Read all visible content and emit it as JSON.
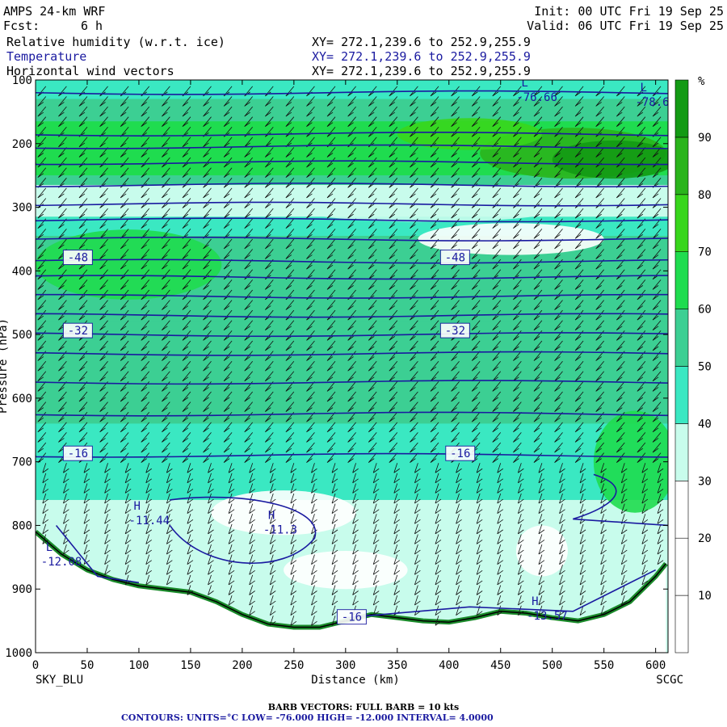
{
  "header": {
    "model": "AMPS 24-km WRF",
    "fcst_label": "Fcst:",
    "fcst_value": "6 h",
    "init": "Init: 00 UTC Fri 19 Sep 25",
    "valid": "Valid: 06 UTC Fri 19 Sep 25",
    "fields": [
      {
        "name": "Relative humidity (w.r.t. ice)",
        "xy": "XY= 272.1,239.6 to 252.9,255.9"
      },
      {
        "name": "Temperature",
        "xy": "XY= 272.1,239.6 to 252.9,255.9"
      },
      {
        "name": "Horizontal wind vectors",
        "xy": "XY= 272.1,239.6 to 252.9,255.9"
      }
    ]
  },
  "colors": {
    "temperature": "#1a1aa0",
    "terrain": "#000000",
    "rh_scale": [
      "#ffffff",
      "#ffffff",
      "#ffffff",
      "#c8fcec",
      "#3ae8c2",
      "#3ccf93",
      "#1fdc4f",
      "#38d61c",
      "#2ab41c",
      "#139a14",
      "#0a700f"
    ]
  },
  "chart_data": {
    "type": "heatmap",
    "title": "Relative humidity (w.r.t. ice)",
    "xlabel": "Distance (km)",
    "ylabel": "Pressure (hPa)",
    "x_start_label": "SKY_BLU",
    "x_end_label": "SCGC",
    "xlim": [
      0,
      600
    ],
    "ylim": [
      1000,
      100
    ],
    "x_ticks": [
      0,
      50,
      100,
      150,
      200,
      250,
      300,
      350,
      400,
      450,
      500,
      550,
      600
    ],
    "y_ticks": [
      100,
      200,
      300,
      400,
      500,
      600,
      700,
      800,
      900,
      1000
    ],
    "colorbar": {
      "unit": "%",
      "levels": [
        0,
        10,
        20,
        30,
        40,
        50,
        60,
        70,
        80,
        90,
        100
      ],
      "tick_labels": [
        "10",
        "20",
        "30",
        "40",
        "50",
        "60",
        "70",
        "80",
        "90"
      ]
    },
    "rh_bands": [
      {
        "p_top": 100,
        "p_bot": 130,
        "rh": 45
      },
      {
        "p_top": 130,
        "p_bot": 165,
        "rh": 55
      },
      {
        "p_top": 165,
        "p_bot": 250,
        "rh": 65
      },
      {
        "p_top": 250,
        "p_bot": 265,
        "rh": 55
      },
      {
        "p_top": 265,
        "p_bot": 315,
        "rh": 35
      },
      {
        "p_top": 315,
        "p_bot": 345,
        "rh": 45
      },
      {
        "p_top": 345,
        "p_bot": 430,
        "rh": 55
      },
      {
        "p_top": 430,
        "p_bot": 480,
        "rh": 55
      },
      {
        "p_top": 480,
        "p_bot": 640,
        "rh": 55
      },
      {
        "p_top": 640,
        "p_bot": 760,
        "rh": 45
      },
      {
        "p_top": 760,
        "p_bot": 1000,
        "rh": 35
      }
    ],
    "rh_features": [
      {
        "x": 520,
        "p": 215,
        "rx": 90,
        "rp": 40,
        "rh": 85
      },
      {
        "x": 560,
        "p": 225,
        "rx": 60,
        "rp": 30,
        "rh": 92
      },
      {
        "x": 420,
        "p": 185,
        "rx": 70,
        "rp": 25,
        "rh": 75
      },
      {
        "x": 90,
        "p": 390,
        "rx": 90,
        "rp": 55,
        "rh": 65
      },
      {
        "x": 380,
        "p": 305,
        "rx": 120,
        "rp": 18,
        "rh": 35
      },
      {
        "x": 460,
        "p": 350,
        "rx": 90,
        "rp": 25,
        "rh": 25
      },
      {
        "x": 240,
        "p": 780,
        "rx": 70,
        "rp": 35,
        "rh": 25
      },
      {
        "x": 300,
        "p": 870,
        "rx": 60,
        "rp": 30,
        "rh": 25
      },
      {
        "x": 490,
        "p": 840,
        "rx": 25,
        "rp": 40,
        "rh": 25
      },
      {
        "x": 580,
        "p": 700,
        "rx": 40,
        "rp": 80,
        "rh": 65
      }
    ],
    "isotherms": [
      {
        "label": "-76.66",
        "p": 120
      },
      {
        "label": "",
        "p": 185
      },
      {
        "label": "",
        "p": 205
      },
      {
        "label": "",
        "p": 230
      },
      {
        "label": "",
        "p": 265
      },
      {
        "label": "",
        "p": 295
      },
      {
        "label": "",
        "p": 320
      },
      {
        "label": "",
        "p": 350
      },
      {
        "label": "-48",
        "p": 385
      },
      {
        "label": "",
        "p": 410
      },
      {
        "label": "",
        "p": 440
      },
      {
        "label": "",
        "p": 470
      },
      {
        "label": "-32",
        "p": 500
      },
      {
        "label": "",
        "p": 530
      },
      {
        "label": "",
        "p": 575
      },
      {
        "label": "",
        "p": 625
      },
      {
        "label": "-16",
        "p": 690
      }
    ],
    "contour_labels": [
      {
        "text": "-48",
        "x": 30,
        "p": 380
      },
      {
        "text": "-48",
        "x": 395,
        "p": 380
      },
      {
        "text": "-32",
        "x": 30,
        "p": 495
      },
      {
        "text": "-32",
        "x": 395,
        "p": 495
      },
      {
        "text": "-16",
        "x": 30,
        "p": 688
      },
      {
        "text": "-16",
        "x": 400,
        "p": 688
      },
      {
        "text": "-16",
        "x": 295,
        "p": 945
      }
    ],
    "extrema": [
      {
        "type": "H",
        "value": "-11.44",
        "x": 95,
        "p": 775
      },
      {
        "type": "H",
        "value": "-11.3",
        "x": 225,
        "p": 790
      },
      {
        "type": "L",
        "value": "-12.08",
        "x": 10,
        "p": 840
      },
      {
        "type": "H",
        "value": "-13.57",
        "x": 480,
        "p": 925
      },
      {
        "type": "L",
        "value": "-76.66",
        "x": 470,
        "p": 110
      },
      {
        "type": "L",
        "value": "-78.6",
        "x": 585,
        "p": 118
      }
    ],
    "terrain_pressure": [
      {
        "x": 0,
        "p": 810
      },
      {
        "x": 25,
        "p": 845
      },
      {
        "x": 50,
        "p": 870
      },
      {
        "x": 75,
        "p": 885
      },
      {
        "x": 100,
        "p": 895
      },
      {
        "x": 125,
        "p": 900
      },
      {
        "x": 150,
        "p": 905
      },
      {
        "x": 175,
        "p": 920
      },
      {
        "x": 200,
        "p": 940
      },
      {
        "x": 225,
        "p": 955
      },
      {
        "x": 250,
        "p": 960
      },
      {
        "x": 275,
        "p": 960
      },
      {
        "x": 300,
        "p": 950
      },
      {
        "x": 325,
        "p": 940
      },
      {
        "x": 350,
        "p": 945
      },
      {
        "x": 375,
        "p": 950
      },
      {
        "x": 400,
        "p": 952
      },
      {
        "x": 425,
        "p": 945
      },
      {
        "x": 450,
        "p": 935
      },
      {
        "x": 475,
        "p": 938
      },
      {
        "x": 500,
        "p": 945
      },
      {
        "x": 525,
        "p": 950
      },
      {
        "x": 550,
        "p": 940
      },
      {
        "x": 575,
        "p": 920
      },
      {
        "x": 600,
        "p": 880
      },
      {
        "x": 610,
        "p": 860
      }
    ],
    "barb_columns_km": [
      10,
      30,
      50,
      70,
      90,
      110,
      130,
      150,
      170,
      190,
      210,
      230,
      250,
      270,
      290,
      310,
      330,
      350,
      370,
      390,
      410,
      430,
      450,
      470,
      490,
      510,
      530,
      550,
      570,
      590,
      605
    ]
  },
  "footer": {
    "barb_text": "BARB VECTORS:  FULL BARB = 10 kts",
    "contour_text": "CONTOURS:  UNITS=°C  LOW= -76.000     HIGH= -12.000     INTERVAL=   4.0000"
  }
}
